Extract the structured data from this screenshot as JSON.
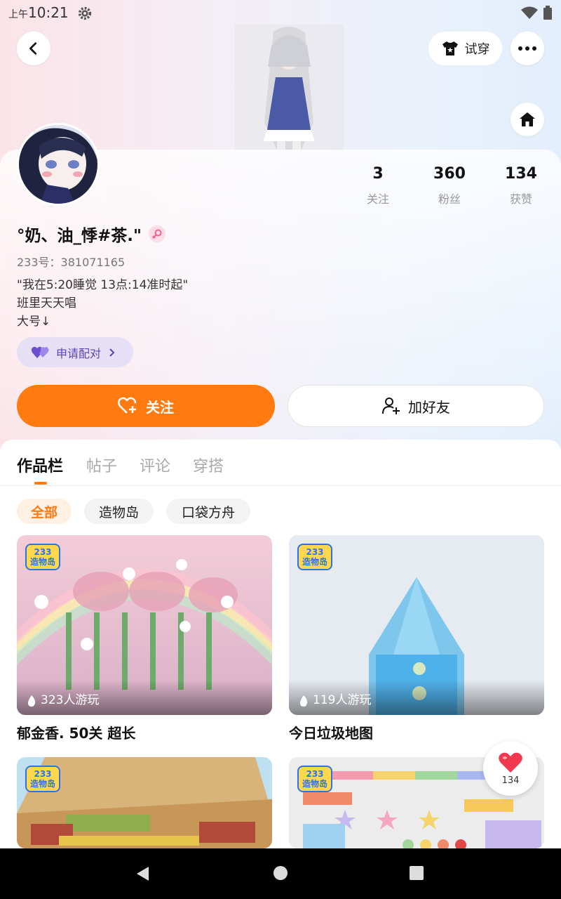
{
  "status_bar": {
    "ampm": "上午",
    "time": "10:21"
  },
  "header": {
    "try_on_label": "试穿"
  },
  "profile": {
    "stats": [
      {
        "value": "3",
        "label": "关注"
      },
      {
        "value": "360",
        "label": "粉丝"
      },
      {
        "value": "134",
        "label": "获赞"
      }
    ],
    "nickname": "°奶、油_悸#茶.\"",
    "uid": "233号：381071165",
    "bio": [
      "\"我在5:20睡觉 13点:14准时起\"",
      "班里天天唱",
      "大号↓"
    ],
    "pair_label": "申请配对",
    "follow_label": "关注",
    "add_friend_label": "加好友"
  },
  "tabs": [
    {
      "label": "作品栏",
      "active": true
    },
    {
      "label": "帖子",
      "active": false
    },
    {
      "label": "评论",
      "active": false
    },
    {
      "label": "穿搭",
      "active": false
    }
  ],
  "filters": [
    {
      "label": "全部",
      "active": true
    },
    {
      "label": "造物岛",
      "active": false
    },
    {
      "label": "口袋方舟",
      "active": false
    }
  ],
  "works": [
    {
      "title": "郁金香. 50关 超长",
      "plays": "323人游玩",
      "badge_top": "233",
      "badge_bottom": "造物岛"
    },
    {
      "title": "今日垃圾地图",
      "plays": "119人游玩",
      "badge_top": "233",
      "badge_bottom": "造物岛"
    },
    {
      "title": "",
      "plays": "",
      "badge_top": "233",
      "badge_bottom": "造物岛"
    },
    {
      "title": "",
      "plays": "",
      "badge_top": "233",
      "badge_bottom": "造物岛"
    }
  ],
  "like_button": {
    "count": "134"
  },
  "colors": {
    "accent": "#ff7a10",
    "pair_purple": "#5b43b8"
  },
  "icons": [
    "back-icon",
    "shirt-icon",
    "more-icon",
    "home-icon",
    "heart-plus-icon",
    "user-plus-icon",
    "fire-icon",
    "heart-icon",
    "gear-icon",
    "wifi-icon",
    "battery-icon"
  ]
}
